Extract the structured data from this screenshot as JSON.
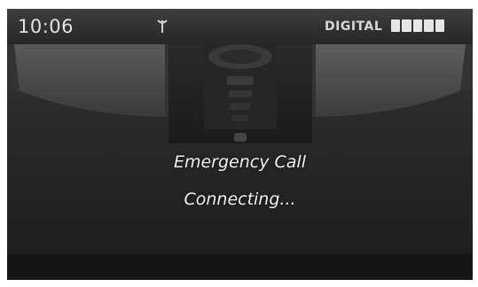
{
  "status_bar": {
    "time": "10:06",
    "antenna_icon": "antenna-icon",
    "radio_mode": "DIGITAL",
    "signal_icon": "signal-strength-icon",
    "signal_level": 5,
    "signal_max": 5
  },
  "message": {
    "title": "Emergency Call",
    "status": "Connecting..."
  },
  "colors": {
    "screen_background": "#2a2a2a",
    "text": "#f0f0f0",
    "status_text": "#e2e2e2"
  }
}
